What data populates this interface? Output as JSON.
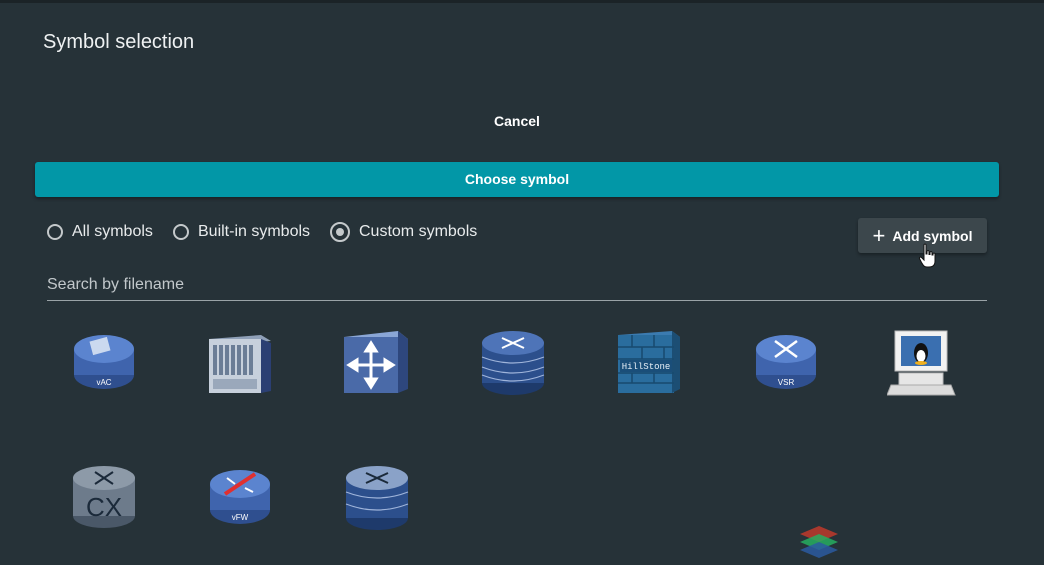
{
  "dialog": {
    "title": "Symbol selection",
    "cancel_label": "Cancel",
    "choose_label": "Choose symbol"
  },
  "filters": {
    "options": [
      {
        "label": "All symbols",
        "selected": false
      },
      {
        "label": "Built-in symbols",
        "selected": false
      },
      {
        "label": "Custom symbols",
        "selected": true
      }
    ]
  },
  "add_button": {
    "label": "Add symbol",
    "icon": "plus-icon"
  },
  "search": {
    "placeholder": "Search by filename",
    "value": ""
  },
  "symbols": [
    {
      "icon": "vac-router-icon",
      "label": "vAC"
    },
    {
      "icon": "chassis-server-icon",
      "label": ""
    },
    {
      "icon": "layer3-switch-icon",
      "label": ""
    },
    {
      "icon": "stacked-router-icon",
      "label": ""
    },
    {
      "icon": "hillstone-firewall-icon",
      "label": "HillStone"
    },
    {
      "icon": "vsr-router-icon",
      "label": "VSR"
    },
    {
      "icon": "linux-workstation-icon",
      "label": ""
    },
    {
      "icon": "cx-switch-icon",
      "label": "CX"
    },
    {
      "icon": "vfw-firewall-icon",
      "label": "vFW"
    },
    {
      "icon": "stacked-router-2-icon",
      "label": ""
    }
  ],
  "colors": {
    "background": "#263238",
    "accent": "#0297a7",
    "secondary_button": "#3c474c",
    "device_blue": "#3f5f9e"
  }
}
